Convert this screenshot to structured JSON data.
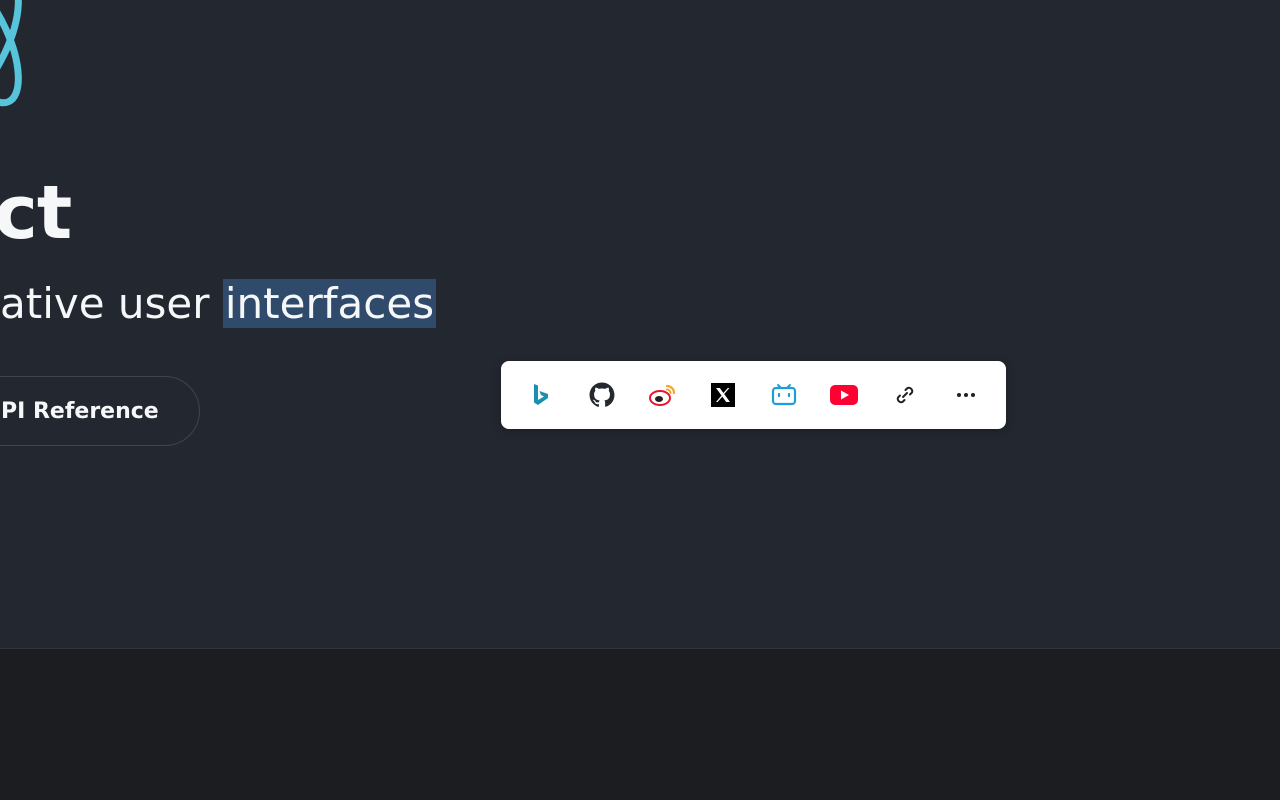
{
  "hero": {
    "title_partial": "ct",
    "tagline_prefix": "ative user ",
    "tagline_selected": "interfaces",
    "api_button_label": "PI Reference"
  },
  "share_toolbar": {
    "items": [
      {
        "icon": "bing-icon",
        "color": "#1b8fb0"
      },
      {
        "icon": "github-icon",
        "color": "#24292f"
      },
      {
        "icon": "weibo-icon",
        "color": "#e6162d"
      },
      {
        "icon": "x-icon",
        "color": "#000000"
      },
      {
        "icon": "bilibili-icon",
        "color": "#1e9ed8"
      },
      {
        "icon": "youtube-icon",
        "color": "#ff0033"
      },
      {
        "icon": "link-icon",
        "color": "#222222"
      },
      {
        "icon": "more-icon",
        "color": "#222222"
      }
    ]
  },
  "colors": {
    "background": "#23272f",
    "footer": "#1b1d21",
    "react_blue": "#58c4dc",
    "selection": "#2f4a6b"
  }
}
